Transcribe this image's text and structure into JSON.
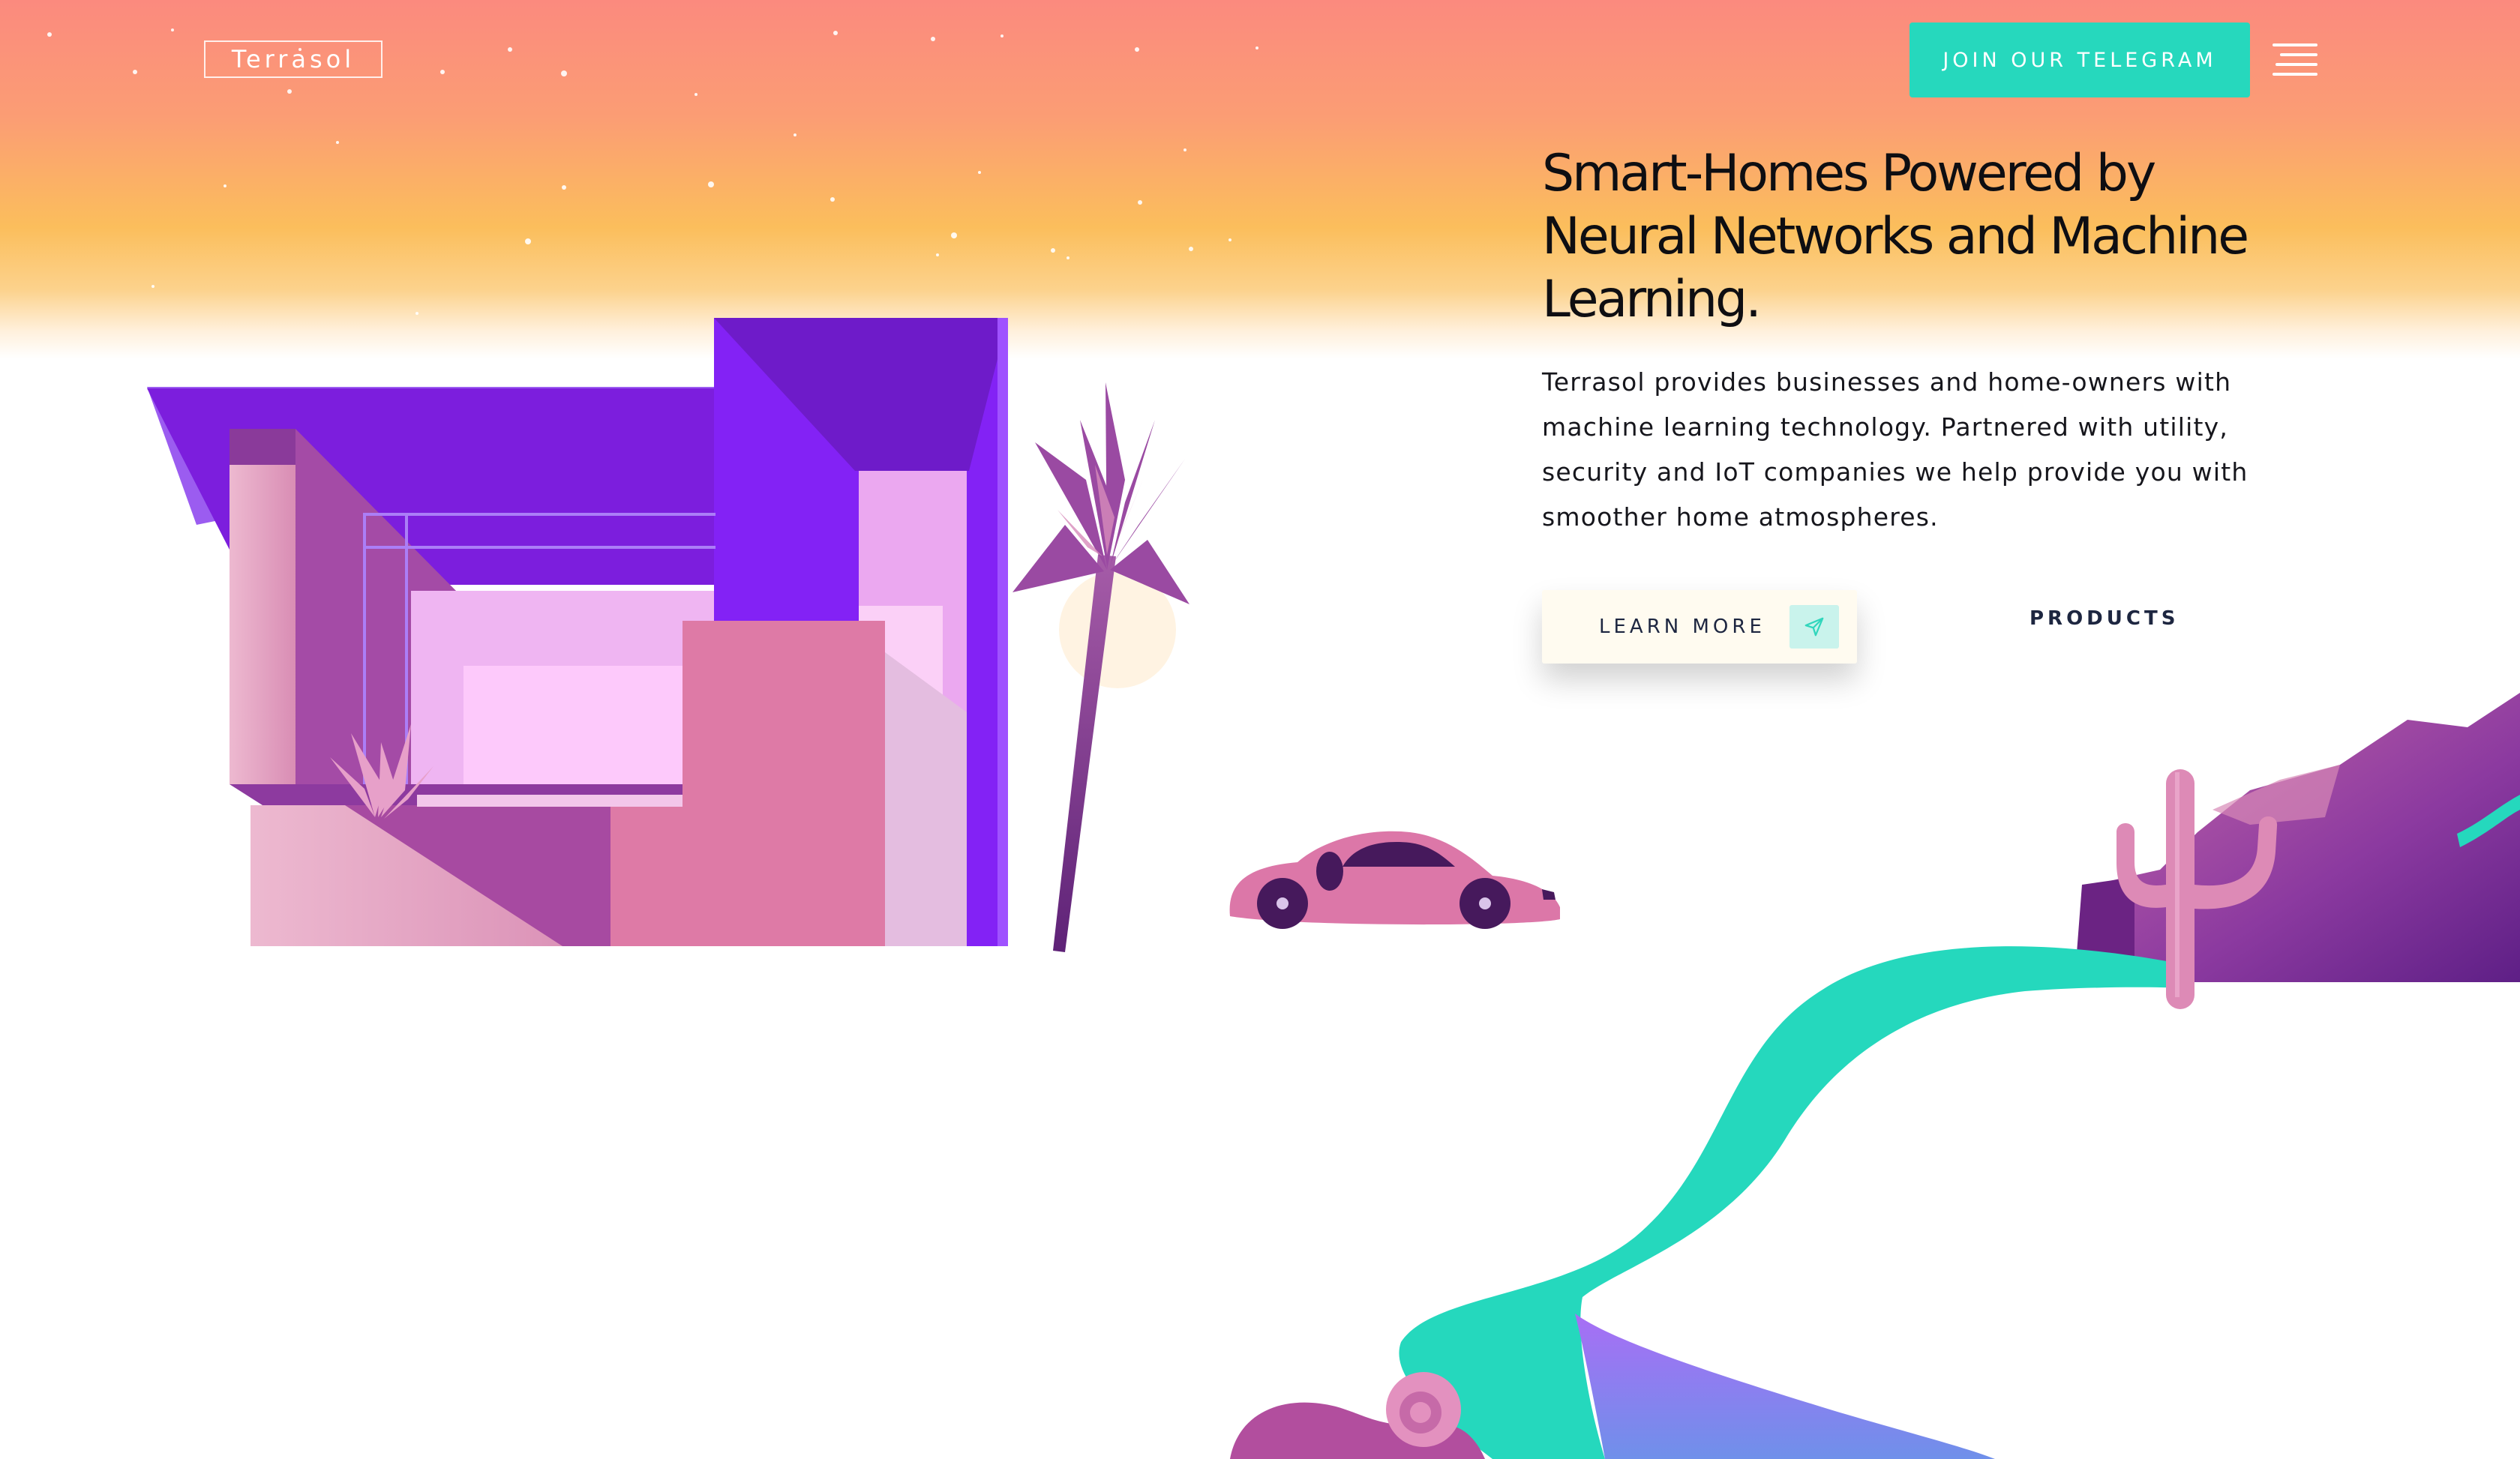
{
  "header": {
    "logo_text": "Terrasol",
    "telegram_button": "JOIN OUR TELEGRAM",
    "menu_icon": "hamburger-menu-icon"
  },
  "hero": {
    "heading": "Smart-Homes Powered by Neural Networks and Machine Learning.",
    "heading_lines": [
      "Smart-Homes Powered by",
      "Neural Networks and Machine",
      "Learning."
    ],
    "description": "Terrasol provides businesses and home-owners with machine learning technology. Partnered with utility, security and IoT companies we help provide you with smoother home atmospheres.",
    "learn_more_button": "LEARN MORE",
    "learn_more_icon": "paper-plane-icon",
    "products_link": "PRODUCTS"
  },
  "colors": {
    "accent_teal": "#26d8bd",
    "sky_top": "#fb8a7e",
    "sky_mid": "#fbbf5a",
    "house_purple": "#7e1fe0",
    "pink": "#e07ba8",
    "heading_text": "#0e0e12"
  }
}
